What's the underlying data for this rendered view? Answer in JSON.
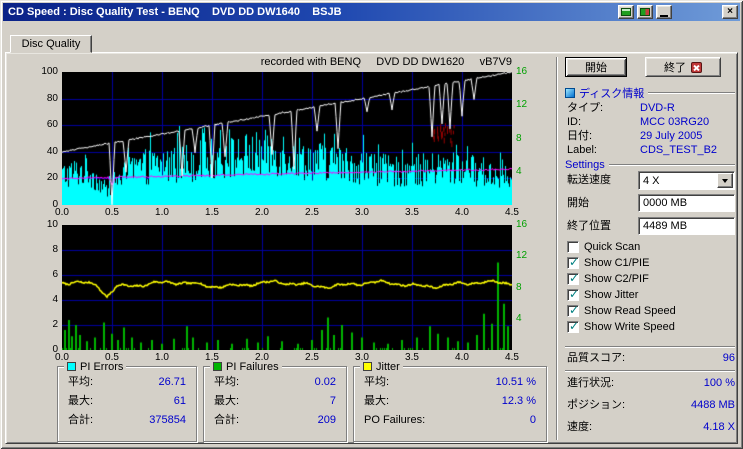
{
  "window": {
    "title": "CD Speed : Disc Quality Test - BENQ    DVD DD DW1640    BSJB",
    "controls": {
      "minimize": "minimize",
      "close": "×"
    }
  },
  "tab": {
    "label": "Disc Quality"
  },
  "chart_header": "recorded with BENQ     DVD DD DW1620     vB7V9",
  "buttons": {
    "start": "開始",
    "exit": "終了"
  },
  "disc_info": {
    "header": "ディスク情報",
    "rows": [
      {
        "label": "タイプ:",
        "value": "DVD-R"
      },
      {
        "label": "ID:",
        "value": "MCC 03RG20"
      },
      {
        "label": "日付:",
        "value": "29 July 2005"
      },
      {
        "label": "Label:",
        "value": "CDS_TEST_B2"
      }
    ]
  },
  "settings": {
    "header": "Settings",
    "speed": {
      "label": "転送速度",
      "value": "4 X"
    },
    "start": {
      "label": "開始",
      "value": "0000 MB"
    },
    "end": {
      "label": "終了位置",
      "value": "4489 MB"
    },
    "checkboxes": [
      {
        "label": "Quick Scan",
        "checked": false
      },
      {
        "label": "Show C1/PIE",
        "checked": true
      },
      {
        "label": "Show C2/PIF",
        "checked": true
      },
      {
        "label": "Show Jitter",
        "checked": true
      },
      {
        "label": "Show Read Speed",
        "checked": true
      },
      {
        "label": "Show Write Speed",
        "checked": true
      }
    ]
  },
  "quality": {
    "label": "品質スコア:",
    "value": "96"
  },
  "status": [
    {
      "label": "進行状況:",
      "value": "100 %"
    },
    {
      "label": "ポジション:",
      "value": "4488 MB"
    },
    {
      "label": "速度:",
      "value": "4.18 X"
    }
  ],
  "stats_boxes": [
    {
      "title": "PI Errors",
      "swatch": "#00ffff",
      "rows": [
        {
          "label": "平均:",
          "value": "26.71"
        },
        {
          "label": "最大:",
          "value": "61"
        },
        {
          "label": "合計:",
          "value": "375854"
        }
      ]
    },
    {
      "title": "PI Failures",
      "swatch": "#00b400",
      "rows": [
        {
          "label": "平均:",
          "value": "0.02"
        },
        {
          "label": "最大:",
          "value": "7"
        },
        {
          "label": "合計:",
          "value": "209"
        }
      ]
    },
    {
      "title": "Jitter",
      "swatch": "#ffff00",
      "rows": [
        {
          "label": "平均:",
          "value": "10.51 %"
        },
        {
          "label": "最大:",
          "value": "12.3 %"
        },
        {
          "label": "PO Failures:",
          "value": "0"
        }
      ]
    }
  ],
  "chart_data": [
    {
      "id": "pi_errors_chart",
      "type": "area",
      "x_axis": {
        "min": 0,
        "max": 4.5,
        "ticks": [
          "0.0",
          "0.5",
          "1.0",
          "1.5",
          "2.0",
          "2.5",
          "3.0",
          "3.5",
          "4.0",
          "4.5"
        ]
      },
      "left_axis": {
        "min": 0,
        "max": 100,
        "ticks": [
          100,
          80,
          60,
          40,
          20,
          0
        ]
      },
      "right_axis": {
        "min": 0,
        "max": 16,
        "ticks": [
          16,
          12,
          8,
          4
        ],
        "color": "#00a000"
      },
      "grid": {
        "x_step": 0.5,
        "y_step": 20,
        "color": "#0000a0"
      },
      "series": [
        {
          "name": "PI Errors",
          "type": "noise_area",
          "color": "#00ffff",
          "average": 26.71,
          "maximum": 61,
          "total": 375854,
          "envelope_x": [
            0,
            0.25,
            0.45,
            0.55,
            0.75,
            1.0,
            1.5,
            2.0,
            2.2,
            2.45,
            2.7,
            3.0,
            3.3,
            3.6,
            3.9,
            4.2,
            4.45,
            4.5
          ],
          "envelope_y": [
            34,
            40,
            16,
            30,
            42,
            46,
            52,
            58,
            60,
            52,
            48,
            44,
            38,
            40,
            42,
            38,
            30,
            22
          ]
        },
        {
          "name": "Read Speed",
          "type": "line",
          "color": "#ffffff",
          "start": 40,
          "end": 100,
          "dips": [
            [
              0.5,
              46
            ],
            [
              0.64,
              24
            ],
            [
              1.2,
              34
            ],
            [
              1.33,
              18
            ],
            [
              1.5,
              40
            ],
            [
              1.63,
              26
            ],
            [
              2.1,
              30
            ],
            [
              2.32,
              44
            ],
            [
              2.55,
              18
            ],
            [
              2.76,
              34
            ],
            [
              3.05,
              10
            ],
            [
              3.3,
              12
            ],
            [
              3.7,
              38
            ],
            [
              3.8,
              30
            ],
            [
              3.88,
              34
            ],
            [
              4.0,
              26
            ],
            [
              4.12,
              16
            ]
          ]
        },
        {
          "name": "Write Speed",
          "type": "line",
          "color": "#ff00ff",
          "start": 20,
          "end": 27,
          "dips": [
            [
              0.5,
              6
            ]
          ]
        },
        {
          "name": "C2 marks",
          "type": "marks",
          "color": "#990000",
          "x_range": [
            3.7,
            3.92
          ],
          "y_range": [
            48,
            62
          ]
        }
      ]
    },
    {
      "id": "jitter_chart",
      "type": "line",
      "x_axis": {
        "min": 0,
        "max": 4.5,
        "ticks": [
          "0.0",
          "0.5",
          "1.0",
          "1.5",
          "2.0",
          "2.5",
          "3.0",
          "3.5",
          "4.0",
          "4.5"
        ]
      },
      "left_axis": {
        "min": 0,
        "max": 10,
        "ticks": [
          10,
          8,
          6,
          4,
          2,
          0
        ]
      },
      "right_axis": {
        "min": 0,
        "max": 16,
        "ticks": [
          16,
          12,
          8,
          4
        ],
        "color": "#00a000"
      },
      "grid": {
        "x_step": 0.5,
        "y_step": 2,
        "color": "#0000a0"
      },
      "series": [
        {
          "name": "Jitter",
          "type": "wavy_line",
          "color": "#ffff00",
          "base": 5.25,
          "average_pct": "10.51 %",
          "max_pct": "12.3 %",
          "dips": [
            [
              0.45,
              0.85
            ]
          ]
        },
        {
          "name": "PI Failures",
          "type": "bars",
          "color": "#00b400",
          "average": 0.02,
          "maximum": 7,
          "total": 209,
          "bars": [
            [
              0.03,
              1.6
            ],
            [
              0.07,
              2.4
            ],
            [
              0.1,
              1.1
            ],
            [
              0.14,
              2.0
            ],
            [
              0.18,
              1.2
            ],
            [
              0.25,
              0.7
            ],
            [
              0.33,
              1.0
            ],
            [
              0.42,
              2.2
            ],
            [
              0.5,
              1.3
            ],
            [
              0.56,
              0.8
            ],
            [
              0.62,
              1.8
            ],
            [
              0.7,
              1.0
            ],
            [
              0.79,
              0.6
            ],
            [
              0.9,
              0.8
            ],
            [
              1.0,
              0.5
            ],
            [
              1.12,
              0.9
            ],
            [
              1.25,
              1.9
            ],
            [
              1.31,
              1.0
            ],
            [
              1.45,
              0.6
            ],
            [
              1.56,
              0.8
            ],
            [
              1.7,
              0.5
            ],
            [
              1.85,
              0.9
            ],
            [
              1.96,
              0.6
            ],
            [
              2.06,
              1.1
            ],
            [
              2.2,
              0.7
            ],
            [
              2.36,
              0.5
            ],
            [
              2.5,
              0.8
            ],
            [
              2.6,
              1.6
            ],
            [
              2.66,
              2.6
            ],
            [
              2.72,
              1.2
            ],
            [
              2.8,
              2.0
            ],
            [
              2.9,
              1.4
            ],
            [
              3.0,
              1.0
            ],
            [
              3.12,
              0.6
            ],
            [
              3.26,
              0.5
            ],
            [
              3.4,
              0.8
            ],
            [
              3.55,
              1.0
            ],
            [
              3.68,
              1.9
            ],
            [
              3.76,
              1.3
            ],
            [
              3.86,
              1.0
            ],
            [
              3.96,
              0.7
            ],
            [
              4.06,
              0.6
            ],
            [
              4.15,
              1.2
            ],
            [
              4.22,
              2.9
            ],
            [
              4.3,
              2.1
            ],
            [
              4.36,
              7.0
            ],
            [
              4.42,
              3.7
            ],
            [
              4.46,
              1.9
            ]
          ]
        }
      ]
    }
  ]
}
